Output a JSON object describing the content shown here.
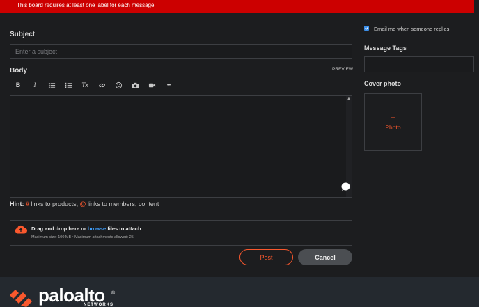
{
  "error": {
    "message": "This board requires at least one label for each message."
  },
  "form": {
    "subject_label": "Subject",
    "subject_placeholder": "Enter a subject",
    "body_label": "Body",
    "preview_label": "PREVIEW",
    "toolbar": [
      "bold",
      "italic",
      "bulleted-list",
      "numbered-list",
      "clear-formatting",
      "link",
      "emoji",
      "photo",
      "video",
      "more"
    ],
    "toolbar_glyphs": {
      "bold": "B",
      "italic": "I",
      "clear": "Tx",
      "more": "•••"
    },
    "hint_prefix": "Hint:",
    "hint_hash": "#",
    "hint_products": "links to products,",
    "hint_at": "@",
    "hint_members": "links to members, content",
    "upload": {
      "title_pre": "Drag and drop here or",
      "browse": "browse",
      "title_post": "files to attach",
      "subtitle": "Maximum size: 100 MB • Maximum attachments allowed: 25"
    },
    "post_button": "Post",
    "cancel_button": "Cancel"
  },
  "sidebar": {
    "email_replies_label": "Email me when someone replies",
    "email_replies_checked": true,
    "tags_label": "Message Tags",
    "cover_photo_label": "Cover photo",
    "photo_plus": "+",
    "photo_label": "Photo"
  },
  "footer": {
    "logo_text": "paloalto",
    "logo_reg": "®",
    "logo_sub": "NETWORKS"
  },
  "colors": {
    "accent": "#fa582d",
    "error": "#cc0000",
    "link": "#3fa0ff",
    "checkbox": "#3b8ee8"
  }
}
